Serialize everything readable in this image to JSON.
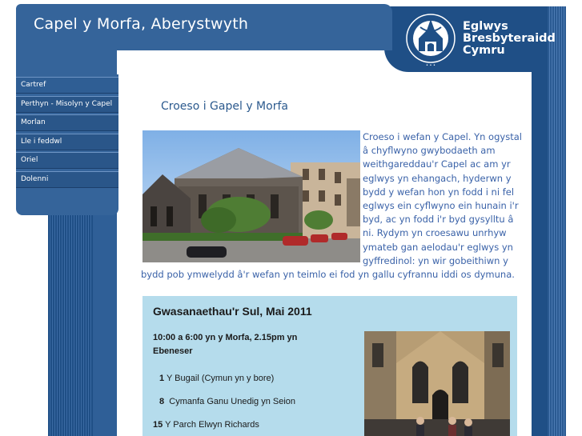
{
  "header": {
    "title": "Capel y Morfa, Aberystwyth"
  },
  "logo": {
    "name_line1": "Eglwys",
    "name_line2": "Bresbyteraidd",
    "name_line3": "Cymru",
    "icon": "church-seal-icon"
  },
  "sidebar": {
    "items": [
      {
        "label": "Cartref"
      },
      {
        "label": "Perthyn - Misolyn y Capel"
      },
      {
        "label": "Morlan"
      },
      {
        "label": "Lle i feddwl"
      },
      {
        "label": "Oriel"
      },
      {
        "label": "Dolenni"
      }
    ]
  },
  "main": {
    "heading": "Croeso i Gapel y Morfa",
    "intro": "Croeso i wefan y Capel. Yn ogystal â chyflwyno gwybodaeth am weithgareddau'r Capel ac am yr eglwys yn ehangach, hyderwn y bydd y wefan hon yn fodd i ni fel eglwys ein cyflwyno ein hunain i'r byd, ac yn fodd i'r byd gysylltu â ni. Rydym yn croesawu unrhyw ymateb gan aelodau'r eglwys yn gyffredinol: yn wir gobeithiwn y bydd pob ymwelydd â'r wefan yn teimlo ei fod yn gallu cyfrannu iddi os dymuna."
  },
  "services": {
    "title": "Gwasanaethau'r Sul, Mai 2011",
    "times": "10:00 a 6:00 yn y Morfa, 2.15pm yn Ebeneser",
    "rows": [
      {
        "num": "1",
        "text": "Y Bugail (Cymun yn y bore)"
      },
      {
        "num": "8",
        "text": "Cymanfa Ganu Unedig yn Seion"
      },
      {
        "num": "15",
        "text": "Y Parch Elwyn Richards"
      }
    ]
  },
  "colors": {
    "brand_blue": "#35649a",
    "dark_blue": "#1f4f86",
    "link_text": "#3a62a8",
    "services_bg": "#b5dcec"
  }
}
